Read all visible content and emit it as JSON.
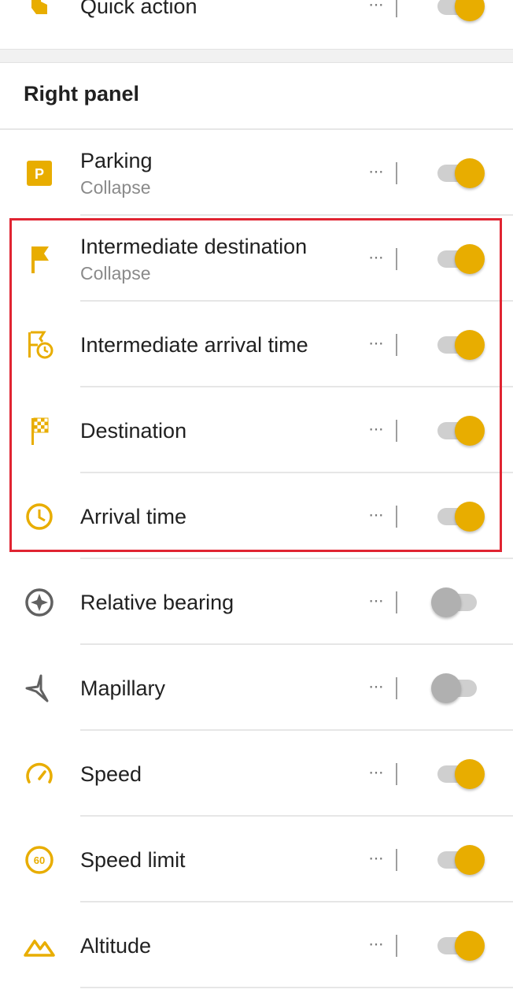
{
  "accent_color": "#e8ad00",
  "highlight_color": "#e02432",
  "top_item": {
    "label": "Quick action",
    "icon": "hand-tap-icon",
    "enabled": true
  },
  "section": {
    "title": "Right panel"
  },
  "widgets": [
    {
      "label": "Parking",
      "sub": "Collapse",
      "icon": "parking-icon",
      "enabled": true
    },
    {
      "label": "Intermediate destination",
      "sub": "Collapse",
      "icon": "flag-icon",
      "enabled": true
    },
    {
      "label": "Intermediate arrival time",
      "sub": "",
      "icon": "flag-clock-icon",
      "enabled": true
    },
    {
      "label": "Destination",
      "sub": "",
      "icon": "checkered-flag-icon",
      "enabled": true
    },
    {
      "label": "Arrival time",
      "sub": "",
      "icon": "clock-icon",
      "enabled": true
    },
    {
      "label": "Relative bearing",
      "sub": "",
      "icon": "compass-icon",
      "enabled": false
    },
    {
      "label": "Mapillary",
      "sub": "",
      "icon": "mapillary-icon",
      "enabled": false
    },
    {
      "label": "Speed",
      "sub": "",
      "icon": "speedometer-icon",
      "enabled": true
    },
    {
      "label": "Speed limit",
      "sub": "",
      "icon": "speed-limit-icon",
      "enabled": true,
      "icon_text": "60"
    },
    {
      "label": "Altitude",
      "sub": "",
      "icon": "mountain-icon",
      "enabled": true
    }
  ],
  "more_glyph": "···"
}
